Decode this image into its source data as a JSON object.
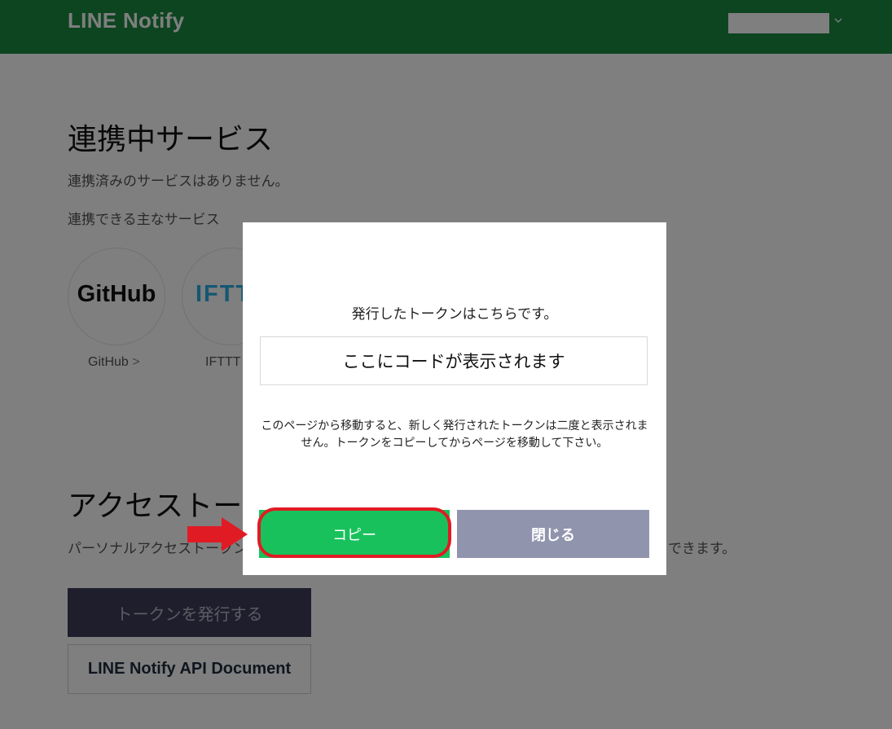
{
  "header": {
    "logo": "LINE Notify",
    "user_menu_icon": "chevron-down-icon"
  },
  "connected": {
    "title": "連携中サービス",
    "empty_text": "連携済みのサービスはありません。",
    "available_label": "連携できる主なサービス",
    "services": [
      {
        "logo": "GitHub",
        "name": "GitHub",
        "arrow": ">"
      },
      {
        "logo": "IFTTT",
        "name": "IFTTT"
      }
    ]
  },
  "access_token": {
    "title": "アクセストーク",
    "description_start": "パーソナルアクセストークンを",
    "description_end": "できます。",
    "issue_button": "トークンを発行する",
    "doc_button": "LINE Notify API Document"
  },
  "modal": {
    "heading": "発行したトークンはこちらです。",
    "token_value": "ここにコードが表示されます",
    "note": "このページから移動すると、新しく発行されたトークンは二度と表示されません。トークンをコピーしてからページを移動して下さい。",
    "copy_button": "コピー",
    "close_button": "閉じる"
  },
  "annotation": {
    "arrow_color": "#e01b24",
    "ring_color": "#e01b24"
  },
  "colors": {
    "header_green": "#1a8a43",
    "copy_green": "#19c15c",
    "close_gray": "#9094ad"
  }
}
